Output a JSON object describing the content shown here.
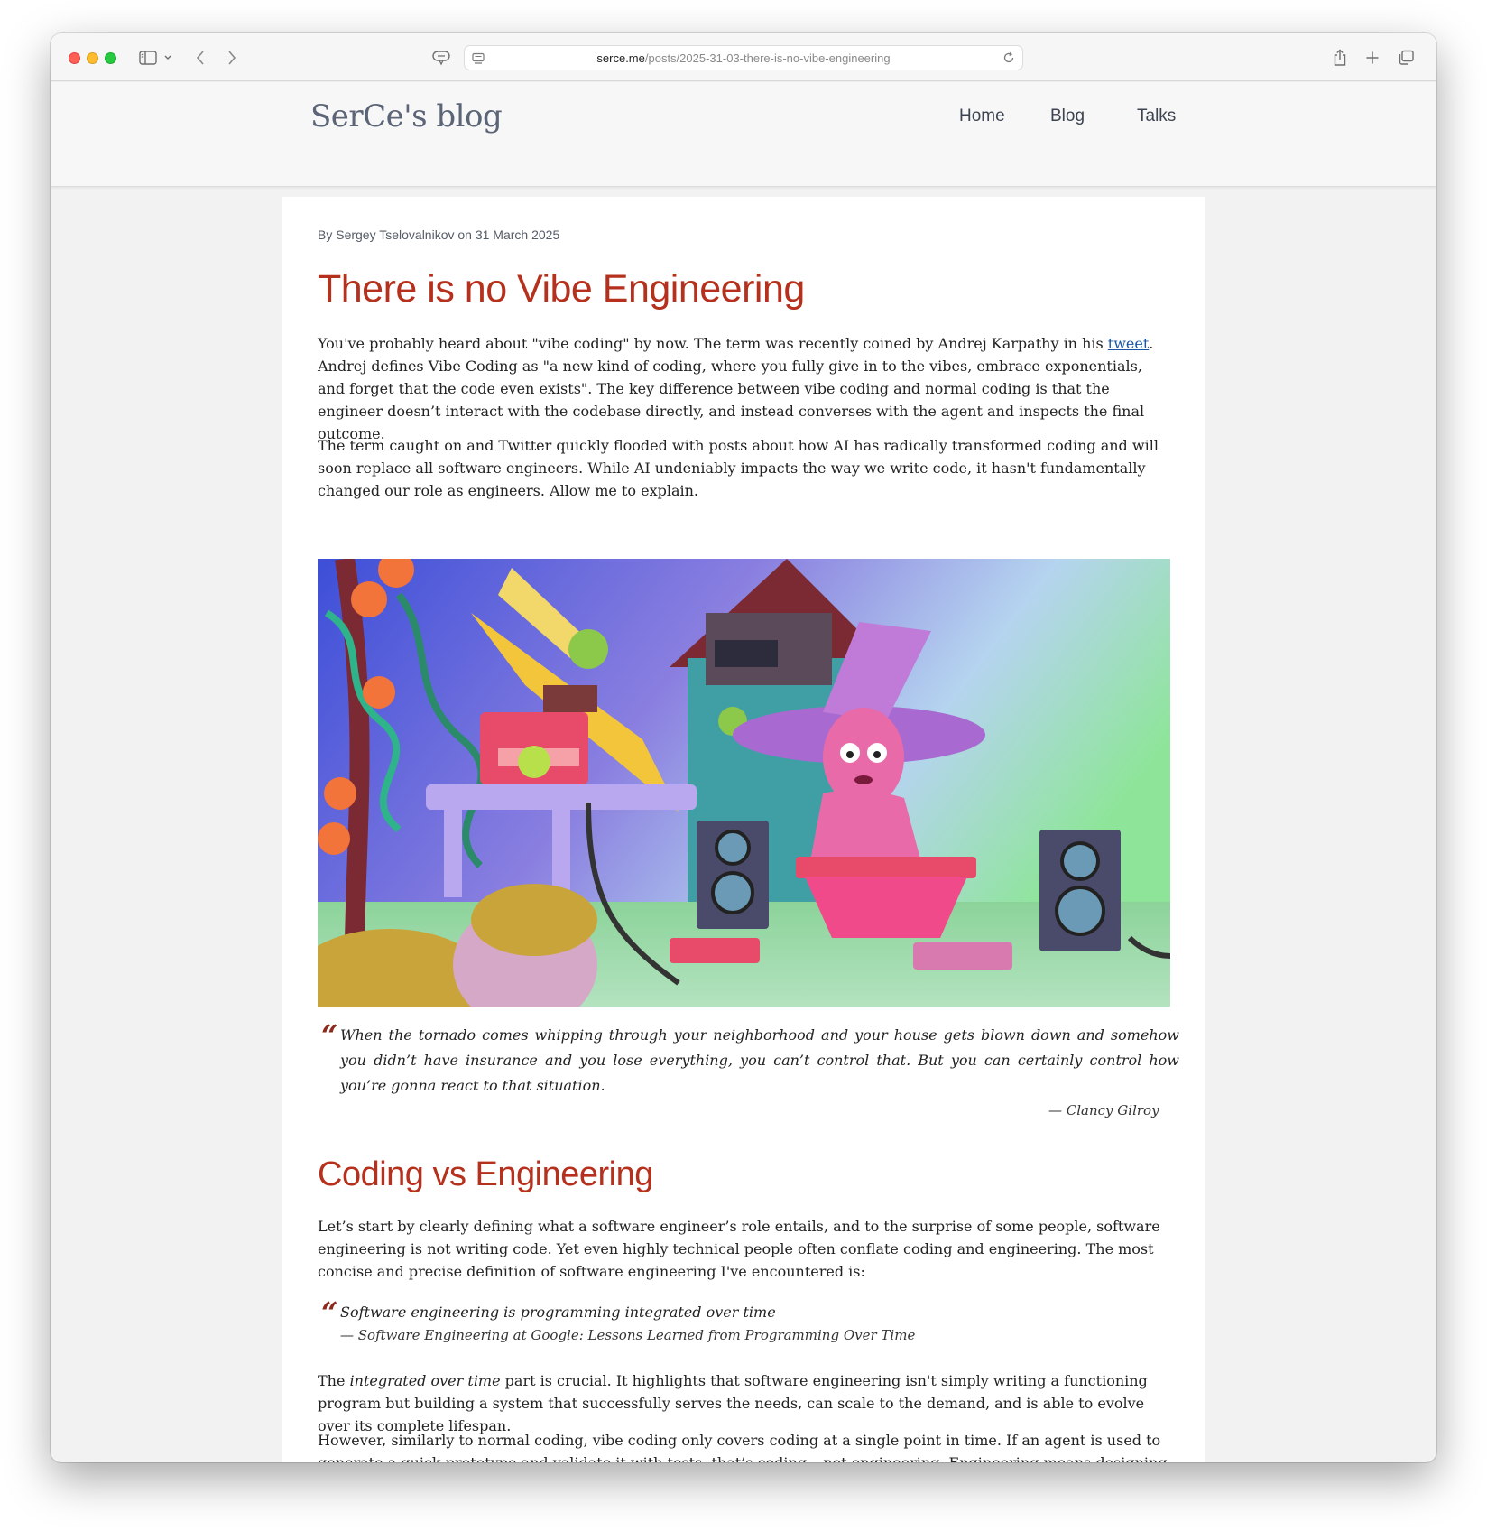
{
  "browser": {
    "url_domain": "serce.me",
    "url_path": "/posts/2025-31-03-there-is-no-vibe-engineering"
  },
  "site": {
    "logo": "SerCe's blog",
    "nav": [
      "Home",
      "Blog",
      "Talks"
    ]
  },
  "post": {
    "byline": "By Sergey Tselovalnikov on 31 March 2025",
    "title": "There is no Vibe Engineering",
    "p1_a": "You've probably heard about \"vibe coding\" by now. The term was recently coined by Andrej Karpathy in his ",
    "p1_link": "tweet",
    "p1_b": ". Andrej defines Vibe Coding as \"a new kind of coding, where you fully give in to the vibes, embrace exponentials, and forget that the code even exists\". The key difference between vibe coding and normal coding is that the engineer doesn’t interact with the codebase directly, and instead converses with the agent and inspects the final outcome.",
    "p2": "The term caught on and Twitter quickly flooded with posts about how AI has radically transformed coding and will soon replace all software engineers. While AI undeniably impacts the way we write code, it hasn't fundamentally changed our role as engineers. Allow me to explain.",
    "quote1": "When the tornado comes whipping through your neighborhood and your house gets blown down and somehow you didn’t have insurance and you lose everything, you can’t control that. But you can certainly control how you’re gonna react to that situation.",
    "quote1_cite": "— Clancy Gilroy",
    "h2": "Coding vs Engineering",
    "p3": "Let’s start by clearly defining what a software engineer’s role entails, and to the surprise of some people, software engineering is not writing code. Yet even highly technical people often conflate coding and engineering. The most concise and precise definition of software engineering I've encountered is:",
    "quote2": "Software engineering is programming integrated over time",
    "quote2_cite": "— Software Engineering at Google: Lessons Learned from Programming Over Time",
    "p4_a": "The ",
    "p4_em": "integrated over time",
    "p4_b": " part is crucial. It highlights that software engineering isn't simply writing a functioning program but building a system that successfully serves the needs, can scale to the demand, and is able to evolve over its complete lifespan.",
    "p5": "However, similarly to normal coding, vibe coding only covers coding at a single point in time. If an agent is used to generate a quick prototype and validate it with tests, that’s coding – not engineering. Engineering means designing systems capable of withstanding real-world conditions, sustaining workloads, resisting security threats, migrating and supporting users’ data in"
  },
  "colors": {
    "title_red": "#b5301d",
    "quote_mark": "#8c2a1c",
    "link_blue": "#1a56a5"
  }
}
